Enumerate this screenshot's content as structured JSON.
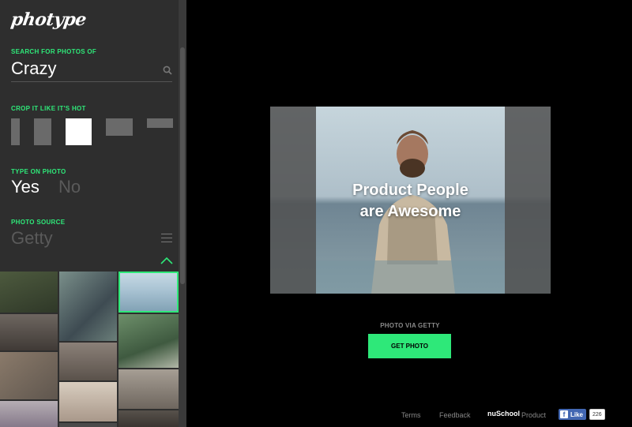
{
  "app": {
    "logo": "photype"
  },
  "sidebar": {
    "search": {
      "label": "SEARCH FOR PHOTOS OF",
      "value": "Crazy"
    },
    "crop": {
      "label": "CROP IT LIKE IT'S HOT",
      "selected": "square"
    },
    "type_on_photo": {
      "label": "TYPE ON PHOTO",
      "yes": "Yes",
      "no": "No",
      "selected": "Yes"
    },
    "photo_source": {
      "label": "PHOTO SOURCE",
      "value": "Getty"
    }
  },
  "preview": {
    "text_line1": "Product People",
    "text_line2": "are Awesome"
  },
  "main": {
    "credit": "PHOTO VIA GETTY",
    "get_photo": "GET PHOTO"
  },
  "footer": {
    "terms": "Terms",
    "feedback": "Feedback",
    "nuschool": "nuSchool",
    "product": "Product",
    "fb_like": "Like",
    "fb_count": "226"
  },
  "colors": {
    "accent": "#2ee879",
    "sidebar_bg": "#2e2e2e",
    "main_bg": "#000000"
  }
}
